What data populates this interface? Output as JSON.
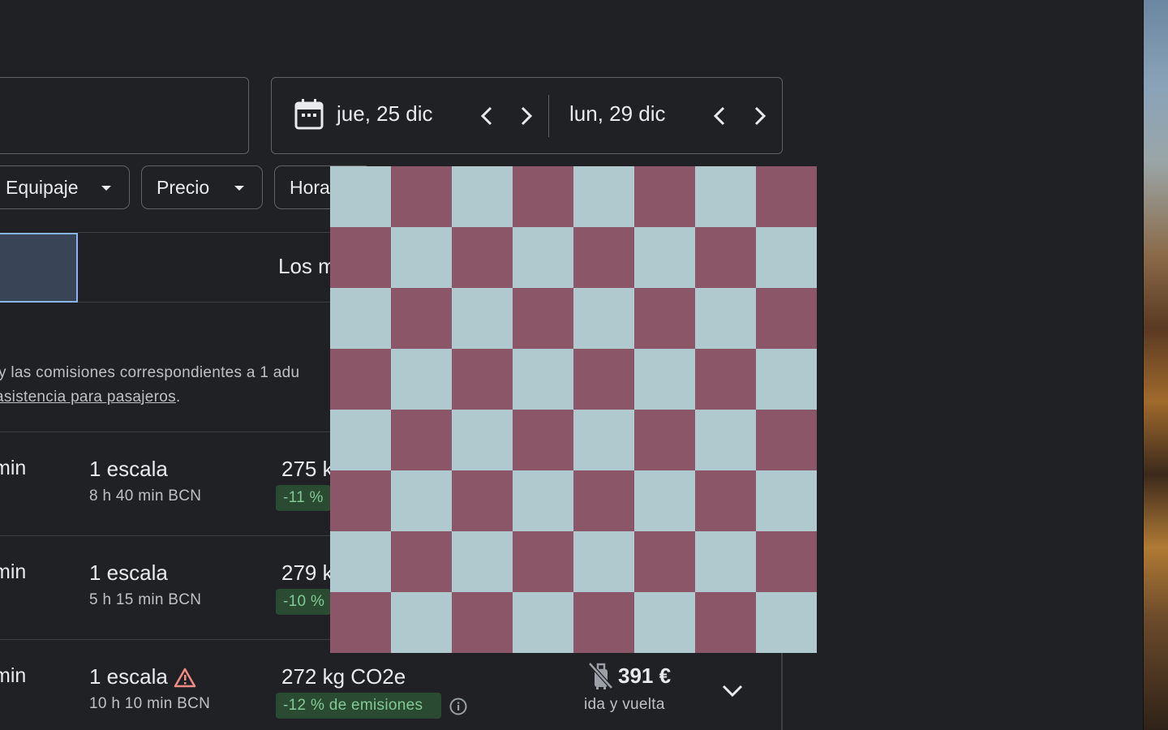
{
  "dates": {
    "departure": "jue, 25 dic",
    "return": "lun, 29 dic"
  },
  "filters": {
    "chips": [
      {
        "label": "Equipaje"
      },
      {
        "label": "Precio"
      },
      {
        "label": "Hora"
      }
    ]
  },
  "tabs": {
    "best_label": "Los m"
  },
  "notice": {
    "line1": "y las comisiones correspondientes a 1 adu",
    "line2_link": "asistencia para pasajeros",
    "line2_end": "."
  },
  "flights": [
    {
      "duration_tail": "min",
      "stops": "1 escala",
      "layover": "8 h 40 min BCN",
      "co2": "275 k",
      "emissions": "-11 %"
    },
    {
      "duration_tail": "min",
      "stops": "1 escala",
      "layover": "5 h 15 min BCN",
      "co2": "279 k",
      "emissions": "-10 %"
    },
    {
      "duration_tail": "min",
      "stops": "1 escala",
      "layover": "10 h 10 min BCN",
      "co2": "272 kg CO2e",
      "emissions": "-12 % de emisiones",
      "price": "391 €",
      "price_sub": "ida y vuelta"
    }
  ],
  "colors": {
    "background": "#202124",
    "checker_light": "#b0c9cf",
    "checker_dark": "#8c5669",
    "emissions_bg": "#2a4a32",
    "emissions_text": "#81c995",
    "warning": "#f28b82"
  },
  "icons": [
    "calendar-icon",
    "chevron-left-icon",
    "chevron-right-icon",
    "caret-down-icon",
    "warning-icon",
    "info-icon",
    "no-carry-on-bag-icon",
    "expand-chevron-icon"
  ]
}
